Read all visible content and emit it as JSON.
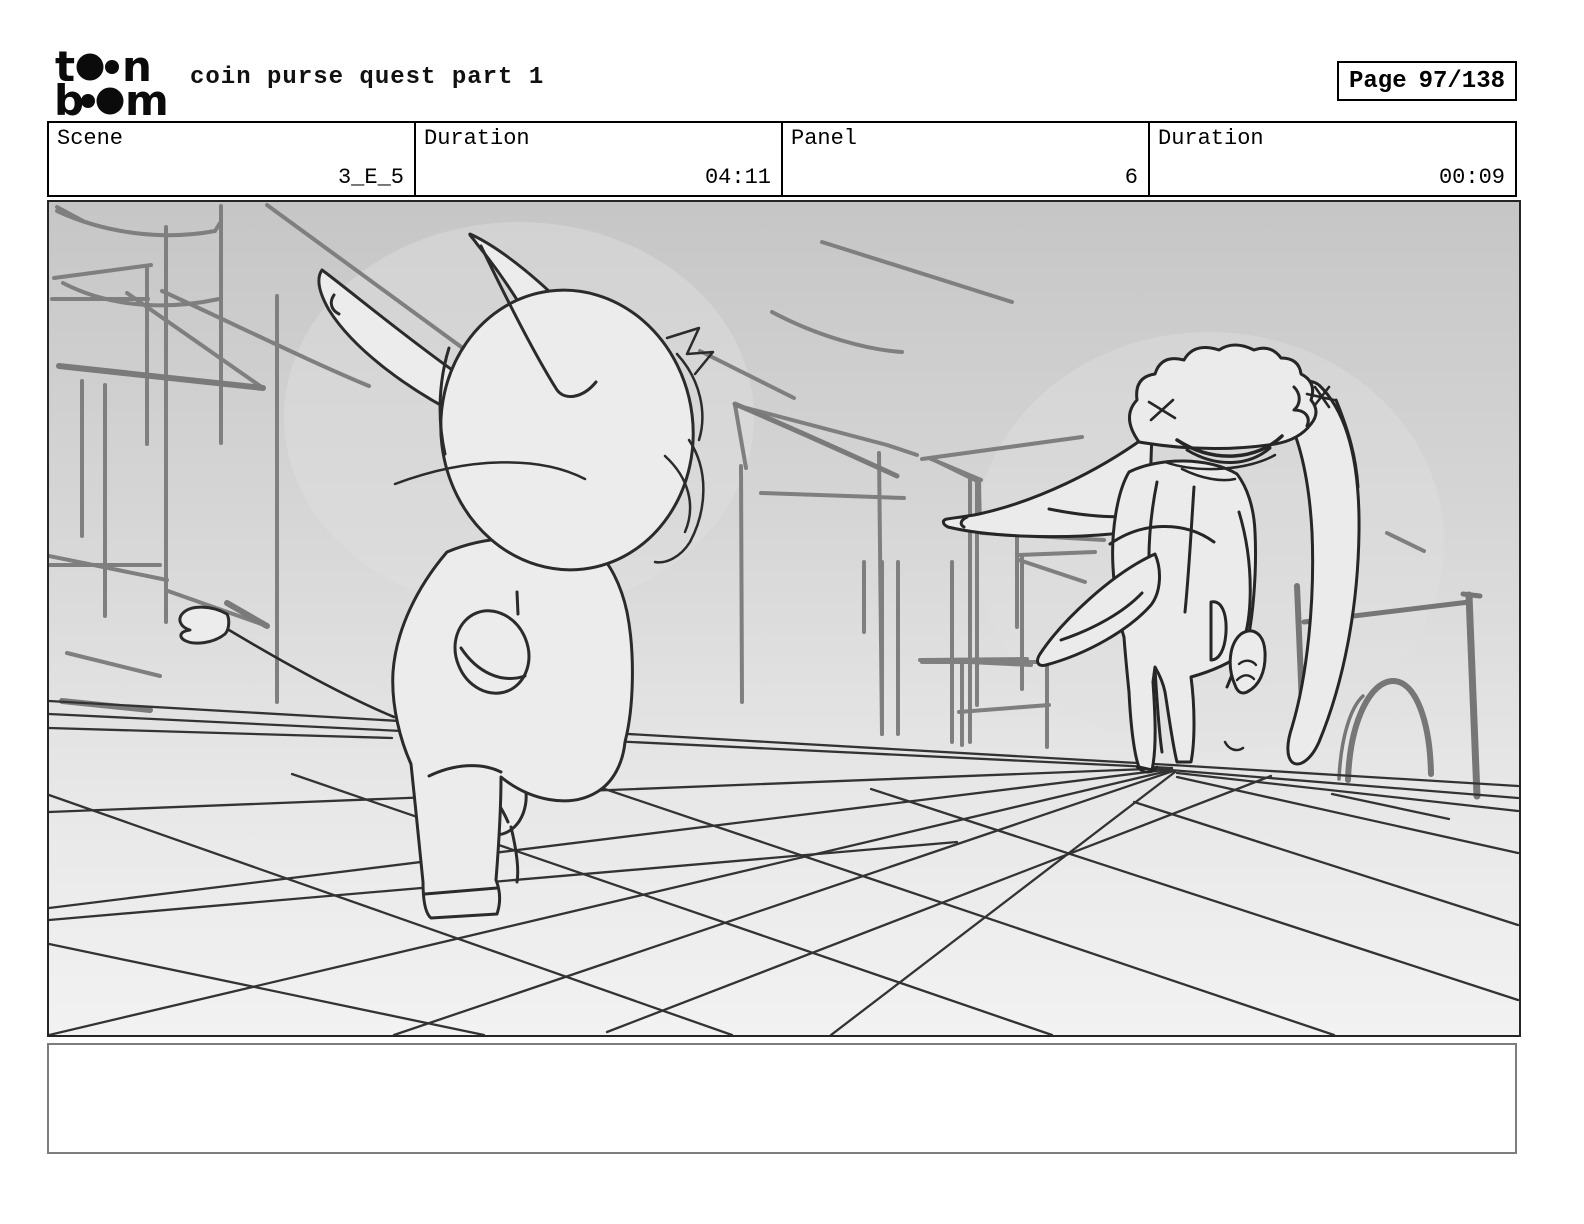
{
  "header": {
    "logo": {
      "line1_left": "t",
      "line1_right": "n",
      "line2_left": "b",
      "line2_right": "m"
    },
    "title": "coin purse quest part 1",
    "page_label": "Page",
    "page_value": "97/138"
  },
  "info_row": {
    "cells": [
      {
        "label": "Scene",
        "value": "3_E_5"
      },
      {
        "label": "Duration",
        "value": "04:11"
      },
      {
        "label": "Panel",
        "value": "6"
      },
      {
        "label": "Duration",
        "value": "00:09"
      }
    ]
  },
  "storyboard_panel": {
    "caption_text": ""
  },
  "colors": {
    "ink": "#111111",
    "sketch_character_line": "#2b2b2b",
    "sketch_background_line": "#7f7f7f",
    "panel_gradient_top": "#c6c6c6",
    "panel_gradient_bottom": "#f2f2f2",
    "caption_border": "#7d7d7d"
  }
}
